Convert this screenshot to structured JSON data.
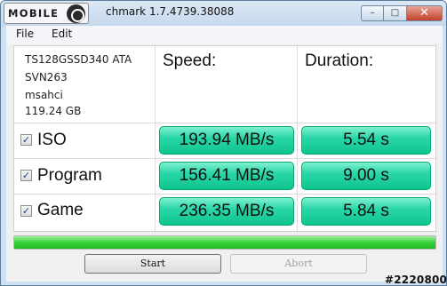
{
  "window": {
    "logo_text": "MOBILE",
    "title": "chmark 1.7.4739.38088",
    "controls": {
      "minimize": "–",
      "maximize": "□",
      "close": "✕"
    }
  },
  "menu": {
    "file": "File",
    "edit": "Edit"
  },
  "device": {
    "model": "TS128GSSD340 ATA",
    "firmware": "SVN263",
    "driver": "msahci",
    "capacity": "119.24 GB"
  },
  "headers": {
    "speed": "Speed:",
    "duration": "Duration:"
  },
  "tests": [
    {
      "name": "ISO",
      "checked": true,
      "speed": "193.94 MB/s",
      "duration": "5.54 s"
    },
    {
      "name": "Program",
      "checked": true,
      "speed": "156.41 MB/s",
      "duration": "9.00 s"
    },
    {
      "name": "Game",
      "checked": true,
      "speed": "236.35 MB/s",
      "duration": "5.84 s"
    }
  ],
  "progress": {
    "value": 1.0,
    "color": "#2ac52a"
  },
  "buttons": {
    "start": "Start",
    "abort": "Abort"
  },
  "watermark": "#2220800",
  "colors": {
    "result_fill": "#1ad19a",
    "titlebar": "#c6d9ec"
  }
}
